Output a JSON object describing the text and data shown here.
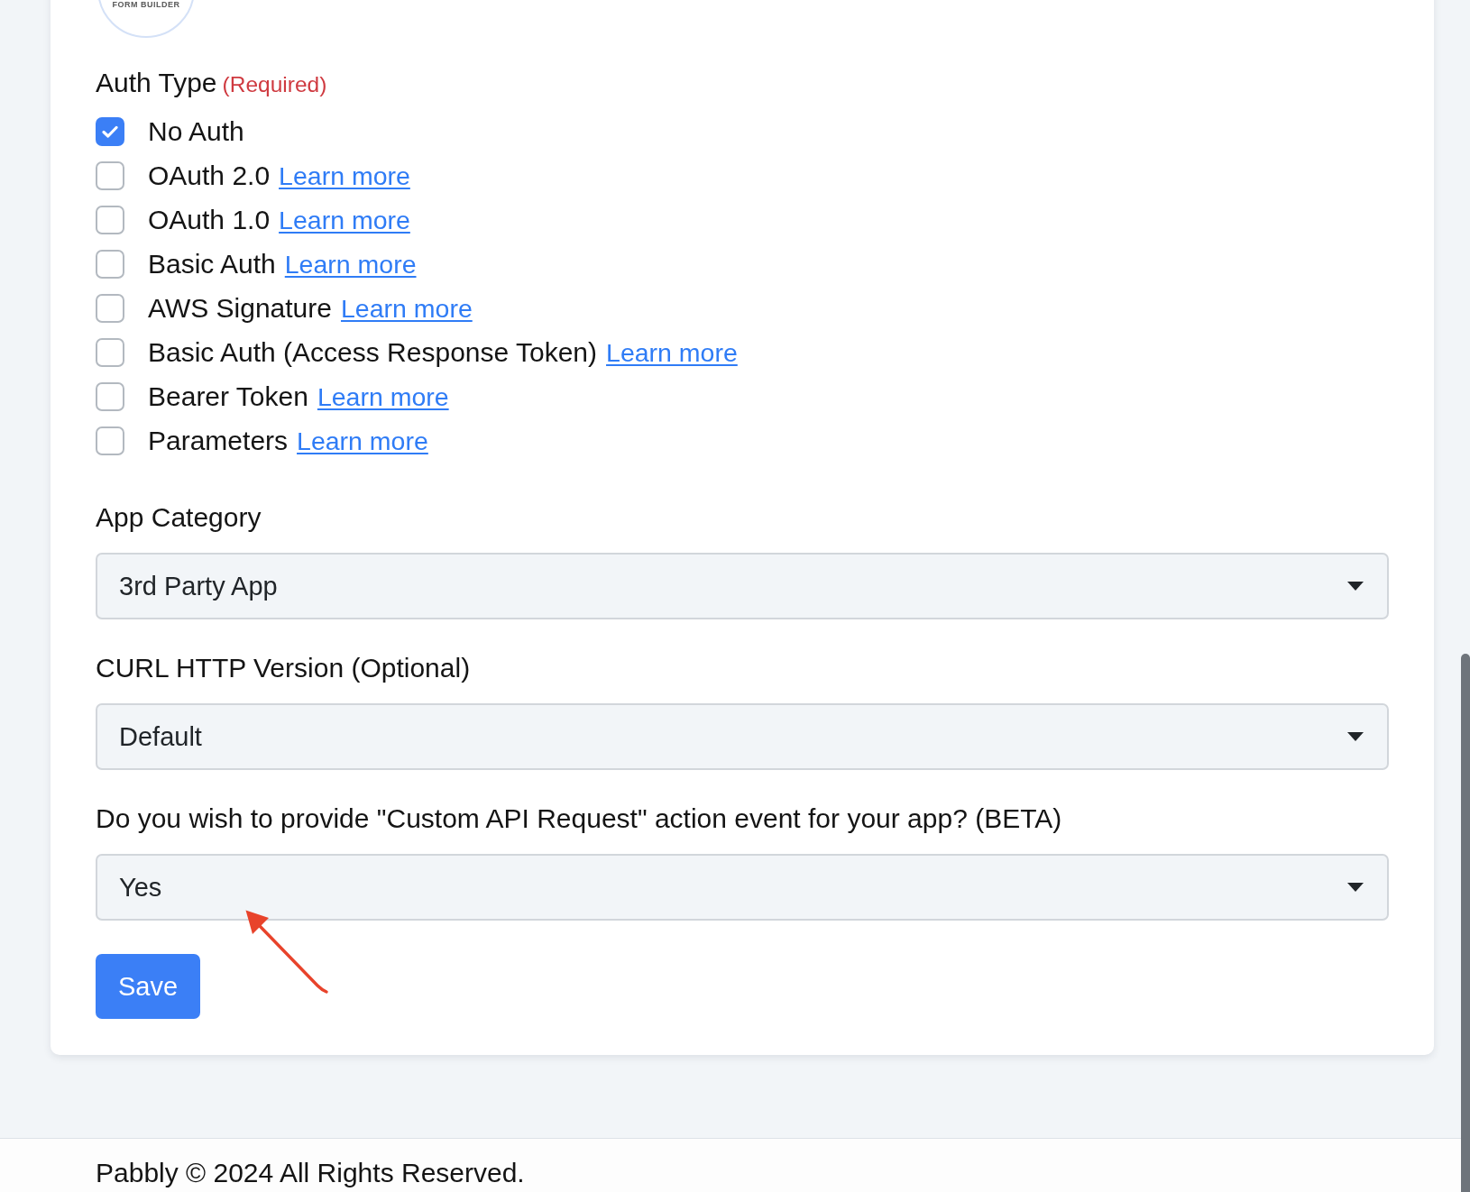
{
  "logo": {
    "caption": "FORM BUILDER"
  },
  "auth_type": {
    "label": "Auth Type",
    "required_note": "(Required)",
    "options": [
      {
        "label": "No Auth",
        "checked": true
      },
      {
        "label": "OAuth 2.0",
        "checked": false,
        "link": "Learn more"
      },
      {
        "label": "OAuth 1.0",
        "checked": false,
        "link": "Learn more"
      },
      {
        "label": "Basic Auth",
        "checked": false,
        "link": "Learn more"
      },
      {
        "label": "AWS Signature",
        "checked": false,
        "link": "Learn more"
      },
      {
        "label": "Basic Auth (Access Response Token)",
        "checked": false,
        "link": "Learn more"
      },
      {
        "label": "Bearer Token",
        "checked": false,
        "link": "Learn more"
      },
      {
        "label": "Parameters",
        "checked": false,
        "link": "Learn more"
      }
    ]
  },
  "fields": [
    {
      "label": "App Category",
      "value": "3rd Party App",
      "pointed_by_arrow": false
    },
    {
      "label": "CURL HTTP Version (Optional)",
      "value": "Default",
      "pointed_by_arrow": false
    },
    {
      "label": "Do you wish to provide \"Custom API Request\" action event for your app? (BETA)",
      "value": "Yes",
      "pointed_by_arrow": true
    }
  ],
  "save_button": {
    "label": "Save"
  },
  "footer": {
    "text": "Pabbly © 2024 All Rights Reserved."
  }
}
